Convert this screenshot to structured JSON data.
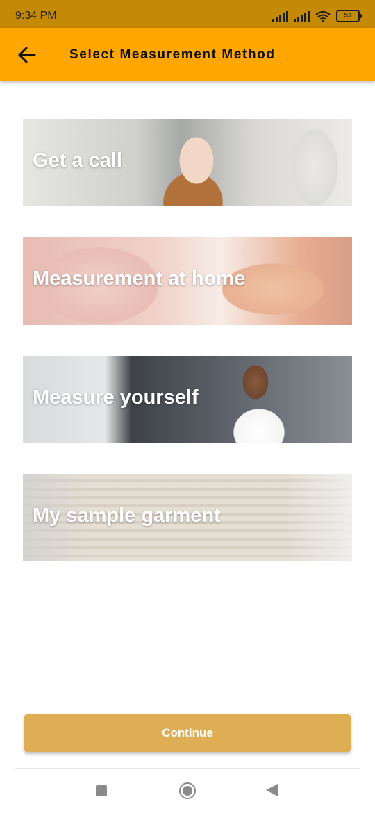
{
  "status_bar": {
    "time": "9:34 PM",
    "battery": "53",
    "icons": [
      "signal-icon",
      "signal-icon",
      "wifi-icon",
      "battery-icon"
    ]
  },
  "app_bar": {
    "title": "Select Measurement Method",
    "back_icon": "arrow-left-icon"
  },
  "options": [
    {
      "label": "Get a call"
    },
    {
      "label": "Measurement at home"
    },
    {
      "label": "Measure yourself"
    },
    {
      "label": "My sample garment"
    }
  ],
  "continue_button": {
    "label": "Continue"
  },
  "colors": {
    "status_bar": "#c58a05",
    "app_bar": "#ffa600",
    "continue_button": "#deae54"
  },
  "nav_bar": {
    "icons": [
      "recent-apps-icon",
      "home-icon",
      "back-icon"
    ]
  }
}
